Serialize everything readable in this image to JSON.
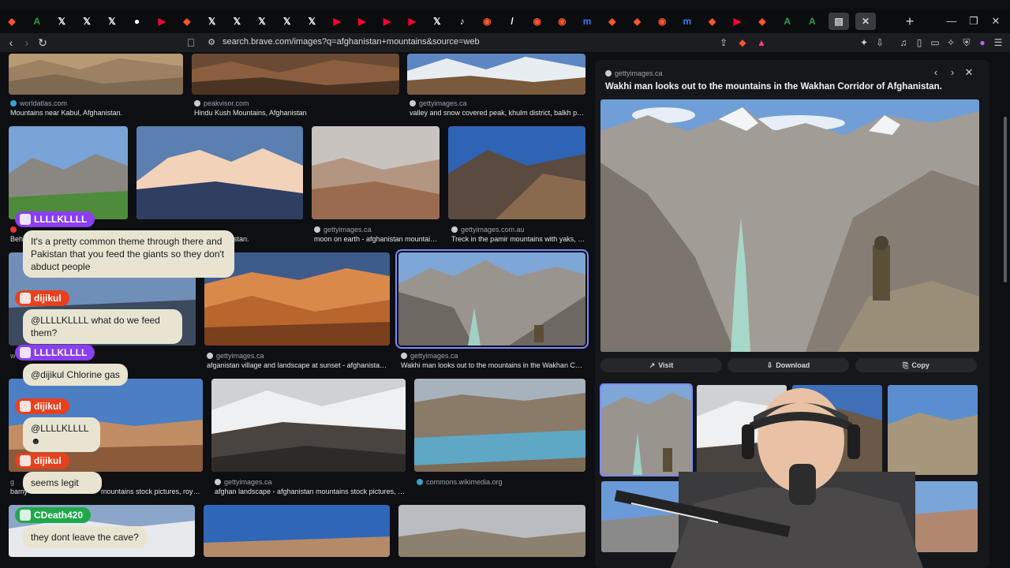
{
  "browser": {
    "url": "search.brave.com/images?q=afghanistan+mountains&source=web",
    "tab_favicons": [
      {
        "name": "brave-icon",
        "color": "#fb542b",
        "glyph": "◆"
      },
      {
        "name": "a-icon",
        "color": "#2e9e4a",
        "glyph": "A"
      },
      {
        "name": "x-icon",
        "color": "#ffffff",
        "glyph": "𝕏"
      },
      {
        "name": "x-icon",
        "color": "#ffffff",
        "glyph": "𝕏"
      },
      {
        "name": "x-icon",
        "color": "#ffffff",
        "glyph": "𝕏"
      },
      {
        "name": "white-circle-icon",
        "color": "#ffffff",
        "glyph": "●"
      },
      {
        "name": "youtube-icon",
        "color": "#ff0033",
        "glyph": "▶"
      },
      {
        "name": "brave-icon",
        "color": "#fb542b",
        "glyph": "◆"
      },
      {
        "name": "x-icon",
        "color": "#ffffff",
        "glyph": "𝕏"
      },
      {
        "name": "x-icon",
        "color": "#ffffff",
        "glyph": "𝕏"
      },
      {
        "name": "x-icon",
        "color": "#ffffff",
        "glyph": "𝕏"
      },
      {
        "name": "x-icon",
        "color": "#ffffff",
        "glyph": "𝕏"
      },
      {
        "name": "x-icon",
        "color": "#ffffff",
        "glyph": "𝕏"
      },
      {
        "name": "youtube-icon",
        "color": "#ff0033",
        "glyph": "▶"
      },
      {
        "name": "youtube-icon",
        "color": "#ff0033",
        "glyph": "▶"
      },
      {
        "name": "youtube-icon",
        "color": "#ff0033",
        "glyph": "▶"
      },
      {
        "name": "youtube-icon",
        "color": "#ff0033",
        "glyph": "▶"
      },
      {
        "name": "x-icon",
        "color": "#ffffff",
        "glyph": "𝕏"
      },
      {
        "name": "tiktok-icon",
        "color": "#ffffff",
        "glyph": "♪"
      },
      {
        "name": "brave-search-icon",
        "color": "#fb542b",
        "glyph": "◉"
      },
      {
        "name": "slash-icon",
        "color": "#ffffff",
        "glyph": "/"
      },
      {
        "name": "brave-search-icon",
        "color": "#fb542b",
        "glyph": "◉"
      },
      {
        "name": "brave-search-icon",
        "color": "#fb542b",
        "glyph": "◉"
      },
      {
        "name": "m-icon",
        "color": "#3d7bff",
        "glyph": "m"
      },
      {
        "name": "brave-icon",
        "color": "#fb542b",
        "glyph": "◆"
      },
      {
        "name": "brave-icon",
        "color": "#fb542b",
        "glyph": "◆"
      },
      {
        "name": "brave-search-icon",
        "color": "#fb542b",
        "glyph": "◉"
      },
      {
        "name": "m-icon",
        "color": "#3d7bff",
        "glyph": "m"
      },
      {
        "name": "brave-icon",
        "color": "#fb542b",
        "glyph": "◆"
      },
      {
        "name": "youtube-icon",
        "color": "#ff0033",
        "glyph": "▶"
      },
      {
        "name": "brave-icon",
        "color": "#fb542b",
        "glyph": "◆"
      },
      {
        "name": "a-icon",
        "color": "#2e9e4a",
        "glyph": "A"
      },
      {
        "name": "a-icon",
        "color": "#2e9e4a",
        "glyph": "A"
      },
      {
        "name": "doc-icon",
        "color": "#cfd2d8",
        "glyph": "▤"
      }
    ]
  },
  "results": {
    "row1": [
      {
        "source": "worldatlas.com",
        "caption": "Mountains near Kabul, Afghanistan."
      },
      {
        "source": "peakvisor.com",
        "caption": "Hindu Kush Mountains, Afghanistan"
      },
      {
        "source": "gettyimages.ca",
        "caption": "valley and snow covered peak, khulm district, balkh prov..."
      }
    ],
    "row2": [
      {
        "source": "",
        "caption": "Behi"
      },
      {
        "source": "",
        "caption": "ghanistan."
      },
      {
        "source": "gettyimages.ca",
        "caption": "moon on earth - afghanistan mountains ..."
      },
      {
        "source": "gettyimages.com.au",
        "caption": "Treck in the pamir mountains with yaks, bi..."
      }
    ],
    "row3": [
      {
        "source": "w",
        "caption": ""
      },
      {
        "source": "gettyimages.ca",
        "caption": "afganistan village and landscape at sunset - afghanistan mo..."
      },
      {
        "source": "gettyimages.ca",
        "caption": "Wakhi man looks out to the mountains in the Wakhan Corrid..."
      }
    ],
    "row4": [
      {
        "source": "g",
        "caption": "bamy"
      },
      {
        "source": "",
        "caption": "mountains stock pictures, royalt..."
      },
      {
        "source": "gettyimages.ca",
        "caption": "afghan landscape - afghanistan mountains stock pictures, roy..."
      },
      {
        "source": "commons.wikimedia.org",
        "caption": ""
      }
    ]
  },
  "preview": {
    "source": "gettyimages.ca",
    "title": "Wakhi man looks out to the mountains in the Wakhan Corridor of Afghanistan.",
    "buttons": {
      "visit": "Visit",
      "download": "Download",
      "copy": "Copy"
    }
  },
  "chat": [
    {
      "user": "LLLLKLLLL",
      "color": "#8a3ff2",
      "message": "It's a pretty common theme through there and Pakistan that you feed the giants so they don't abduct people"
    },
    {
      "user": "dijikul",
      "color": "#e8401d",
      "message": "@LLLLKLLLL what do we feed them?"
    },
    {
      "user": "LLLLKLLLL",
      "color": "#8a3ff2",
      "message": "@dijikul Chlorine gas"
    },
    {
      "user": "dijikul",
      "color": "#e8401d",
      "message": "@LLLLKLLLL"
    },
    {
      "user": "dijikul",
      "color": "#e8401d",
      "message": "seems legit"
    },
    {
      "user": "CDeath420",
      "color": "#1fa84a",
      "message": "they dont leave the cave?"
    }
  ]
}
